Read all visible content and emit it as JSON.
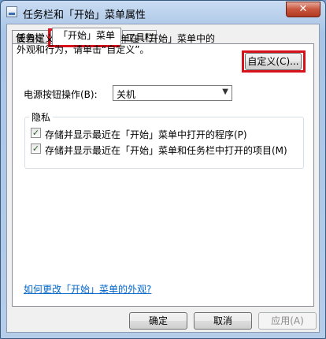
{
  "window": {
    "title": "任务栏和「开始」菜单属性",
    "close_label": "✕"
  },
  "tabs": [
    {
      "label": "任务栏",
      "active": false
    },
    {
      "label": "「开始」菜单",
      "active": true
    },
    {
      "label": "工具栏",
      "active": false
    }
  ],
  "start_menu": {
    "description": "要自定义链接、图标和菜单在「开始」菜单中的\n外观和行为，请单击“自定义”。",
    "customize_label": "自定义(C)...",
    "power_label": "电源按钮操作(B):",
    "power_value": "关机",
    "privacy_title": "隐私",
    "privacy_items": [
      {
        "label": "存储并显示最近在「开始」菜单中打开的程序(P)",
        "checked": true
      },
      {
        "label": "存储并显示最近在「开始」菜单和任务栏中打开的项目(M)",
        "checked": true
      }
    ],
    "help_link": "如何更改「开始」菜单的外观?"
  },
  "footer": {
    "ok_label": "确定",
    "cancel_label": "取消",
    "apply_label": "应用(A)"
  },
  "colors": {
    "highlight": "#d9111a",
    "link": "#0066cc"
  }
}
